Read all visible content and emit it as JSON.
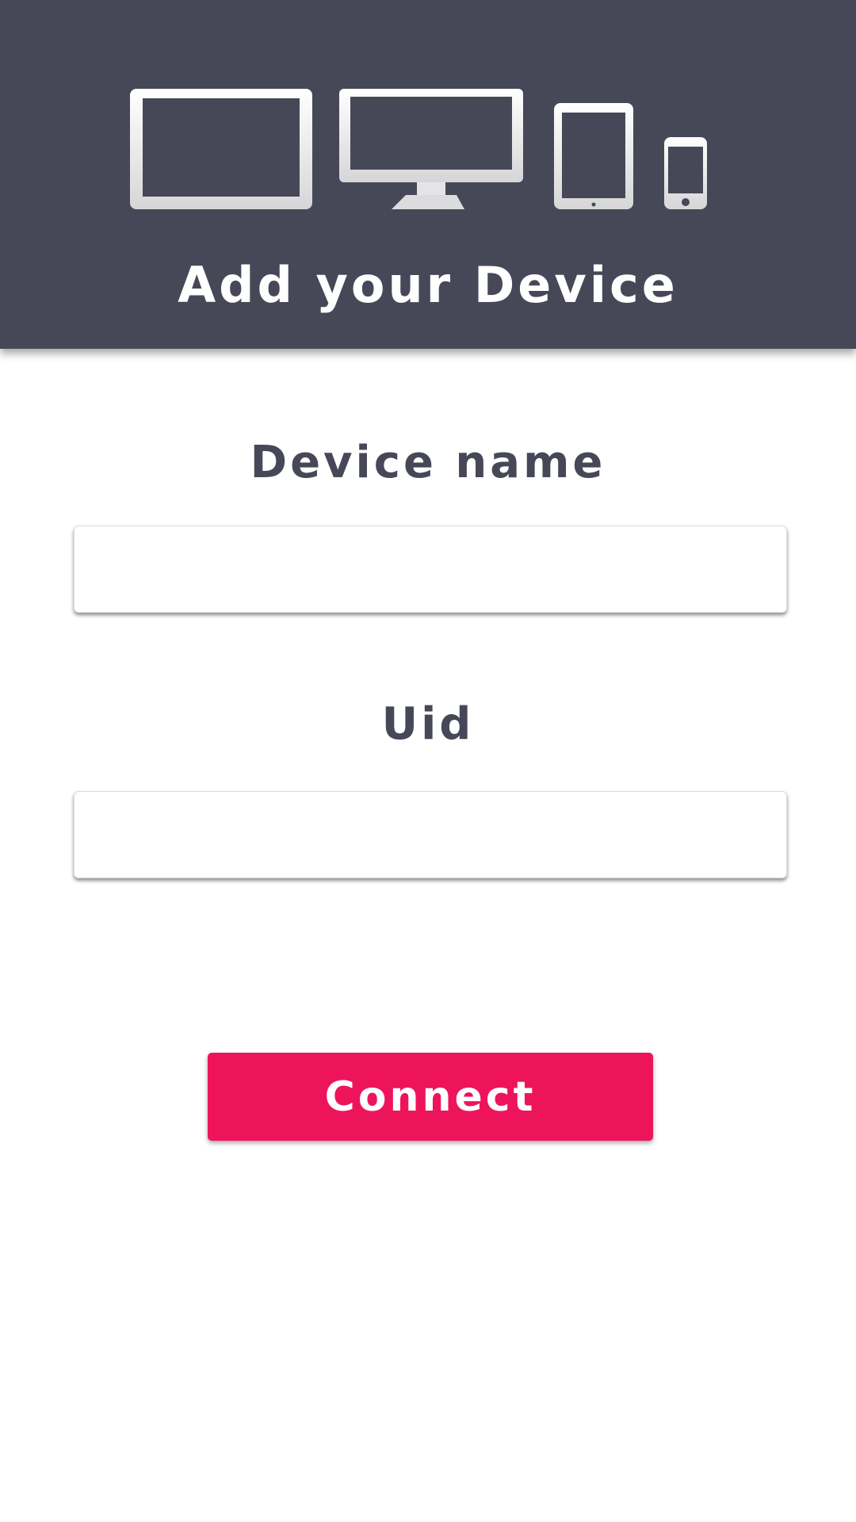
{
  "header": {
    "title": "Add your Device",
    "background_color": "#474857",
    "icons": [
      "laptop-icon",
      "desktop-monitor-icon",
      "tablet-icon",
      "smartphone-icon"
    ]
  },
  "form": {
    "device_name_label": "Device name",
    "device_name_value": "",
    "uid_label": "Uid",
    "uid_value": ""
  },
  "actions": {
    "connect_label": "Connect",
    "connect_color": "#ee145b"
  }
}
